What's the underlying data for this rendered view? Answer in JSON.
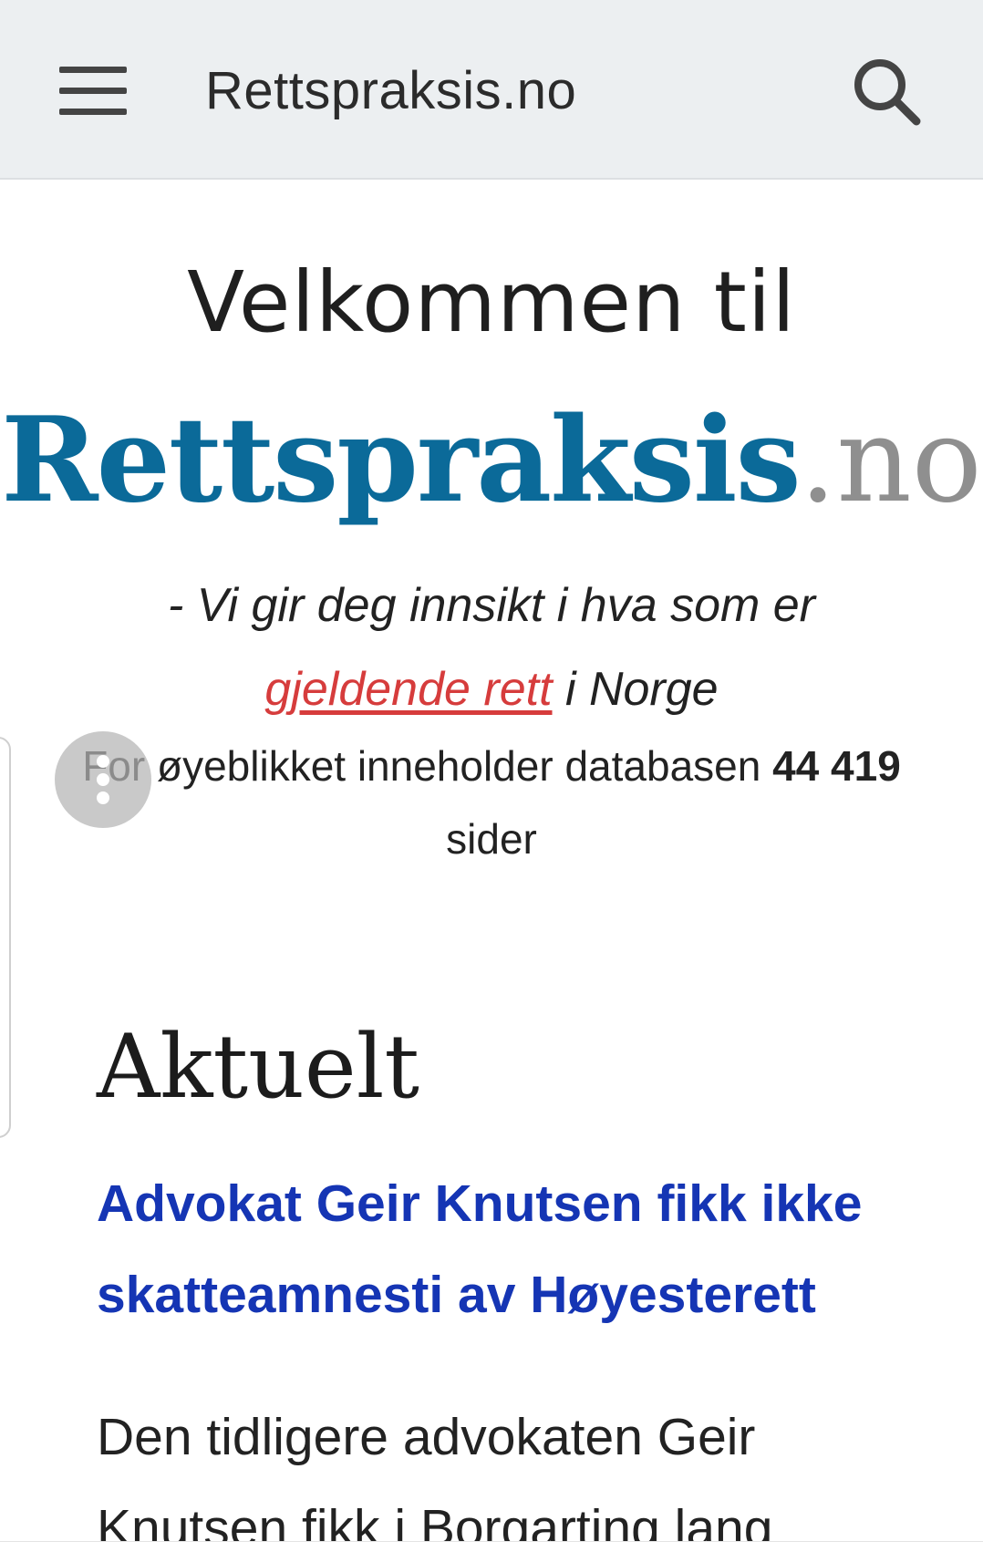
{
  "header": {
    "title": "Rettspraksis.no",
    "menu_icon": "hamburger-icon",
    "search_icon": "search-icon"
  },
  "hero": {
    "welcome": "Velkommen til",
    "brand_main": "Rettspraksis",
    "brand_tld": ".no",
    "tagline_prefix": "- Vi gir deg innsikt i hva som er",
    "tagline_link": "gjeldende rett",
    "tagline_suffix": " i Norge",
    "db_text_before": "For øyeblikket inneholder databasen ",
    "db_count": "44 419",
    "db_text_after": "sider"
  },
  "news": {
    "section_title": "Aktuelt",
    "article_title": "Advokat Geir Knutsen fikk ikke skatteamnesti av Høyesterett",
    "article_excerpt": "Den tidligere advokaten Geir Knutsen fikk i Borgarting lang"
  },
  "colors": {
    "brand_blue": "#0b6a99",
    "tld_gray": "#8f8f8f",
    "link_red": "#d63c3c",
    "headline_blue": "#1535b4",
    "topbar_bg": "#eceff1"
  },
  "float_menu_icon": "vertical-dots-icon"
}
